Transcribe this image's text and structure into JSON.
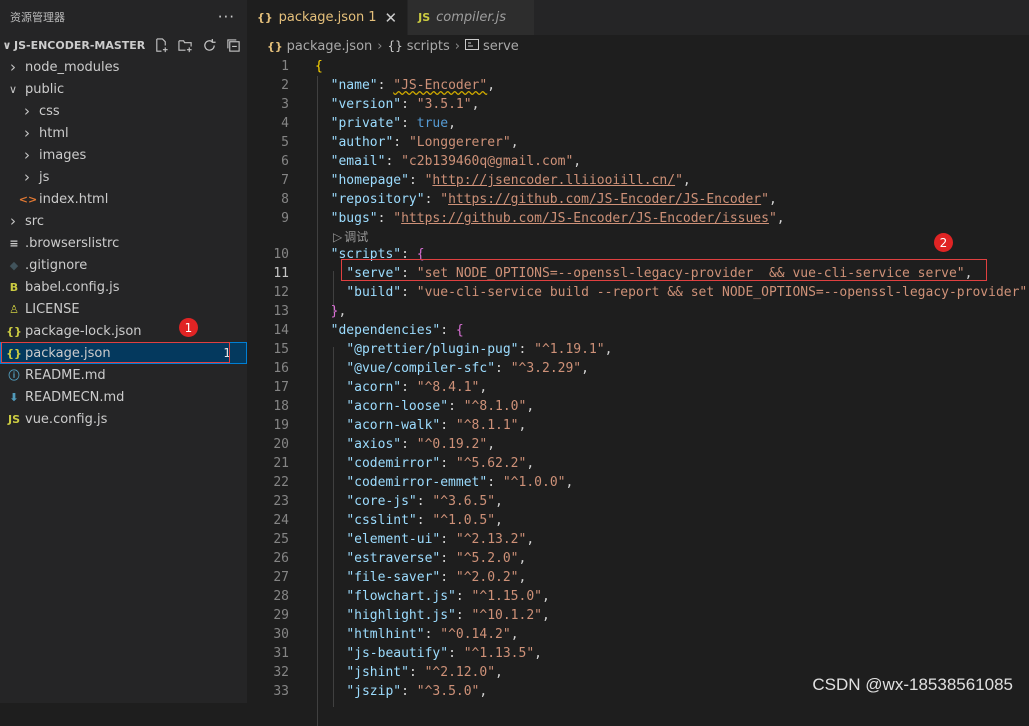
{
  "sidebar": {
    "title": "资源管理器",
    "more": "···",
    "project": "JS-ENCODER-MASTER",
    "items": [
      {
        "label": "node_modules",
        "type": "folder",
        "open": false,
        "indent": 0
      },
      {
        "label": "public",
        "type": "folder",
        "open": true,
        "indent": 0
      },
      {
        "label": "css",
        "type": "folder",
        "open": false,
        "indent": 1
      },
      {
        "label": "html",
        "type": "folder",
        "open": false,
        "indent": 1
      },
      {
        "label": "images",
        "type": "folder",
        "open": false,
        "indent": 1
      },
      {
        "label": "js",
        "type": "folder",
        "open": false,
        "indent": 1
      },
      {
        "label": "index.html",
        "type": "html",
        "indent": 1
      },
      {
        "label": "src",
        "type": "folder",
        "open": false,
        "indent": 0
      },
      {
        "label": ".browserslistrc",
        "type": "lines",
        "indent": 0
      },
      {
        "label": ".gitignore",
        "type": "git",
        "indent": 0
      },
      {
        "label": "babel.config.js",
        "type": "babel",
        "indent": 0
      },
      {
        "label": "LICENSE",
        "type": "license",
        "indent": 0
      },
      {
        "label": "package-lock.json",
        "type": "json",
        "indent": 0
      },
      {
        "label": "package.json",
        "type": "json",
        "indent": 0,
        "selected": true,
        "badge": "1"
      },
      {
        "label": "README.md",
        "type": "info",
        "indent": 0
      },
      {
        "label": "READMECN.md",
        "type": "md",
        "indent": 0
      },
      {
        "label": "vue.config.js",
        "type": "js",
        "indent": 0
      }
    ],
    "callout": "1"
  },
  "tabs": [
    {
      "icon": "{}",
      "label": "package.json",
      "suffix": "1",
      "active": true,
      "close": "✕"
    },
    {
      "icon": "JS",
      "label": "compiler.js",
      "active": false
    }
  ],
  "breadcrumb": {
    "file": "package.json",
    "section": "scripts",
    "leaf": "serve"
  },
  "codelens": "调试",
  "callout2": "2",
  "code": [
    {
      "n": 1,
      "html": "<span class='br1'>{</span>"
    },
    {
      "n": 2,
      "html": "  <span class='k'>\"name\"</span>: <span class='s squig'>\"JS-Encoder\"</span>,"
    },
    {
      "n": 3,
      "html": "  <span class='k'>\"version\"</span>: <span class='s'>\"3.5.1\"</span>,"
    },
    {
      "n": 4,
      "html": "  <span class='k'>\"private\"</span>: <span class='b'>true</span>,"
    },
    {
      "n": 5,
      "html": "  <span class='k'>\"author\"</span>: <span class='s'>\"Longgererer\"</span>,"
    },
    {
      "n": 6,
      "html": "  <span class='k'>\"email\"</span>: <span class='s'>\"c2b139460q@gmail.com\"</span>,"
    },
    {
      "n": 7,
      "html": "  <span class='k'>\"homepage\"</span>: <span class='s'>\"<span class='u'>http://jsencoder.lliiooiill.cn/</span>\"</span>,"
    },
    {
      "n": 8,
      "html": "  <span class='k'>\"repository\"</span>: <span class='s'>\"<span class='u'>https://github.com/JS-Encoder/JS-Encoder</span>\"</span>,"
    },
    {
      "n": 9,
      "html": "  <span class='k'>\"bugs\"</span>: <span class='s'>\"<span class='u'>https://github.com/JS-Encoder/JS-Encoder/issues</span>\"</span>,"
    },
    {
      "lens": true
    },
    {
      "n": 10,
      "html": "  <span class='k'>\"scripts\"</span>: <span class='br2'>{</span>"
    },
    {
      "n": 11,
      "cur": true,
      "html": "    <span class='k'>\"serve\"</span>: <span class='s'>\"set NODE_OPTIONS=--openssl-legacy-provider  &amp;&amp; vue-cli-service serve\"</span>,"
    },
    {
      "n": 12,
      "html": "    <span class='k'>\"build\"</span>: <span class='s'>\"vue-cli-service build --report &amp;&amp; set NODE_OPTIONS=--openssl-legacy-provider\"</span>"
    },
    {
      "n": 13,
      "html": "  <span class='br2'>}</span>,"
    },
    {
      "n": 14,
      "html": "  <span class='k'>\"dependencies\"</span>: <span class='br2'>{</span>"
    },
    {
      "n": 15,
      "html": "    <span class='k'>\"@prettier/plugin-pug\"</span>: <span class='s'>\"^1.19.1\"</span>,"
    },
    {
      "n": 16,
      "html": "    <span class='k'>\"@vue/compiler-sfc\"</span>: <span class='s'>\"^3.2.29\"</span>,"
    },
    {
      "n": 17,
      "html": "    <span class='k'>\"acorn\"</span>: <span class='s'>\"^8.4.1\"</span>,"
    },
    {
      "n": 18,
      "html": "    <span class='k'>\"acorn-loose\"</span>: <span class='s'>\"^8.1.0\"</span>,"
    },
    {
      "n": 19,
      "html": "    <span class='k'>\"acorn-walk\"</span>: <span class='s'>\"^8.1.1\"</span>,"
    },
    {
      "n": 20,
      "html": "    <span class='k'>\"axios\"</span>: <span class='s'>\"^0.19.2\"</span>,"
    },
    {
      "n": 21,
      "html": "    <span class='k'>\"codemirror\"</span>: <span class='s'>\"^5.62.2\"</span>,"
    },
    {
      "n": 22,
      "html": "    <span class='k'>\"codemirror-emmet\"</span>: <span class='s'>\"^1.0.0\"</span>,"
    },
    {
      "n": 23,
      "html": "    <span class='k'>\"core-js\"</span>: <span class='s'>\"^3.6.5\"</span>,"
    },
    {
      "n": 24,
      "html": "    <span class='k'>\"csslint\"</span>: <span class='s'>\"^1.0.5\"</span>,"
    },
    {
      "n": 25,
      "html": "    <span class='k'>\"element-ui\"</span>: <span class='s'>\"^2.13.2\"</span>,"
    },
    {
      "n": 26,
      "html": "    <span class='k'>\"estraverse\"</span>: <span class='s'>\"^5.2.0\"</span>,"
    },
    {
      "n": 27,
      "html": "    <span class='k'>\"file-saver\"</span>: <span class='s'>\"^2.0.2\"</span>,"
    },
    {
      "n": 28,
      "html": "    <span class='k'>\"flowchart.js\"</span>: <span class='s'>\"^1.15.0\"</span>,"
    },
    {
      "n": 29,
      "html": "    <span class='k'>\"highlight.js\"</span>: <span class='s'>\"^10.1.2\"</span>,"
    },
    {
      "n": 30,
      "html": "    <span class='k'>\"htmlhint\"</span>: <span class='s'>\"^0.14.2\"</span>,"
    },
    {
      "n": 31,
      "html": "    <span class='k'>\"js-beautify\"</span>: <span class='s'>\"^1.13.5\"</span>,"
    },
    {
      "n": 32,
      "html": "    <span class='k'>\"jshint\"</span>: <span class='s'>\"^2.12.0\"</span>,"
    },
    {
      "n": 33,
      "html": "    <span class='k'>\"jszip\"</span>: <span class='s'>\"^3.5.0\"</span>,"
    }
  ],
  "watermark": "CSDN @wx-18538561085",
  "colors": {
    "accent": "#007fd4",
    "highlight": "#e02424",
    "background": "#1e1e1e",
    "sidebar": "#252526"
  }
}
